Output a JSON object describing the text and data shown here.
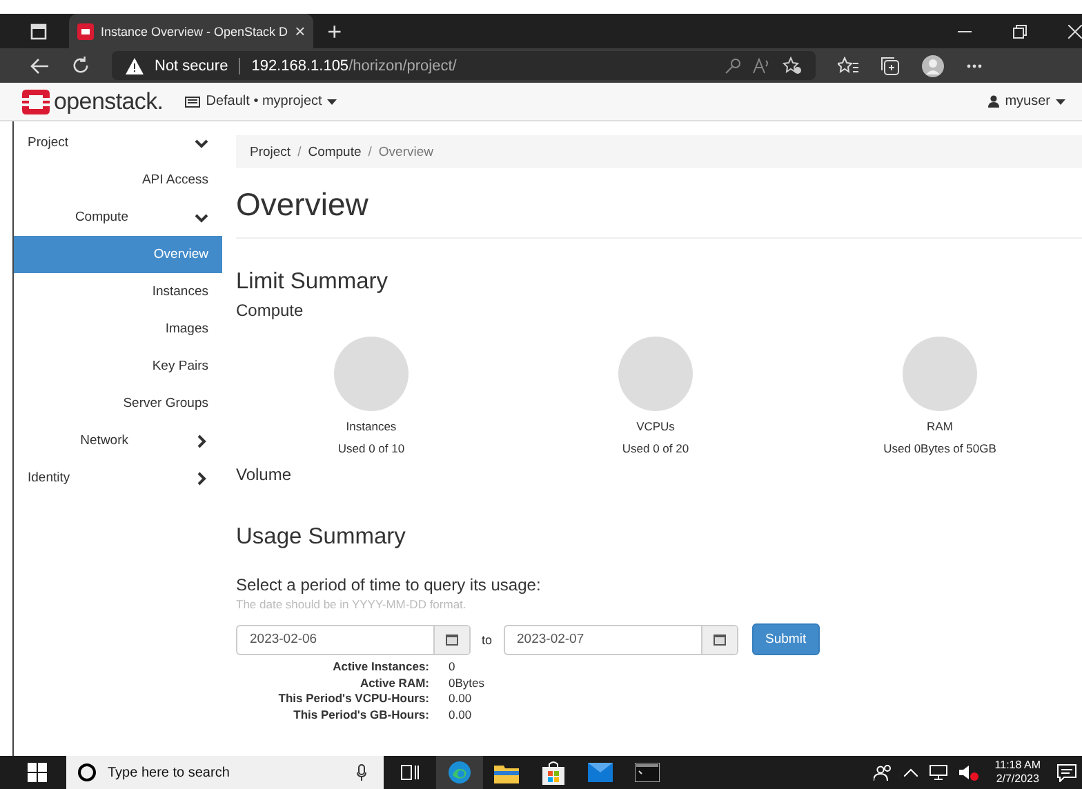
{
  "browser": {
    "tab_title": "Instance Overview - OpenStack D",
    "tab_close": "×",
    "new_tab": "+",
    "not_secure": "Not secure",
    "url_host": "192.168.1.105",
    "url_path": "/horizon/project/"
  },
  "navbar": {
    "brand": "openstack.",
    "project_menu": "Default • myproject",
    "user_menu": "myuser"
  },
  "sidebar": [
    {
      "label": "Project",
      "kind": "section",
      "expanded": true,
      "selected": false
    },
    {
      "label": "API Access",
      "kind": "link",
      "selected": false
    },
    {
      "label": "Compute",
      "kind": "group",
      "expanded": true,
      "selected": false
    },
    {
      "label": "Overview",
      "kind": "link",
      "selected": true
    },
    {
      "label": "Instances",
      "kind": "link",
      "selected": false
    },
    {
      "label": "Images",
      "kind": "link",
      "selected": false
    },
    {
      "label": "Key Pairs",
      "kind": "link",
      "selected": false
    },
    {
      "label": "Server Groups",
      "kind": "link",
      "selected": false
    },
    {
      "label": "Network",
      "kind": "group",
      "expanded": false,
      "selected": false
    },
    {
      "label": "Identity",
      "kind": "section",
      "expanded": false,
      "selected": false
    }
  ],
  "breadcrumb": [
    "Project",
    "Compute",
    "Overview"
  ],
  "breadcrumb_separator": "/",
  "page_title": "Overview",
  "limit_summary": {
    "title": "Limit Summary",
    "compute_heading": "Compute",
    "charts": [
      {
        "label": "Instances",
        "usage": "Used 0 of 10"
      },
      {
        "label": "VCPUs",
        "usage": "Used 0 of 20"
      },
      {
        "label": "RAM",
        "usage": "Used 0Bytes of 50GB"
      }
    ],
    "volume_heading": "Volume"
  },
  "usage_summary": {
    "title": "Usage Summary",
    "prompt": "Select a period of time to query its usage:",
    "hint": "The date should be in YYYY-MM-DD format.",
    "start_date": "2023-02-06",
    "to": "to",
    "end_date": "2023-02-07",
    "submit": "Submit",
    "stats": [
      {
        "label": "Active Instances:",
        "value": "0"
      },
      {
        "label": "Active RAM:",
        "value": "0Bytes"
      },
      {
        "label": "This Period's VCPU-Hours:",
        "value": "0.00"
      },
      {
        "label": "This Period's GB-Hours:",
        "value": "0.00"
      }
    ]
  },
  "taskbar": {
    "search_placeholder": "Type here to search",
    "time": "11:18 AM",
    "date": "2/7/2023"
  }
}
